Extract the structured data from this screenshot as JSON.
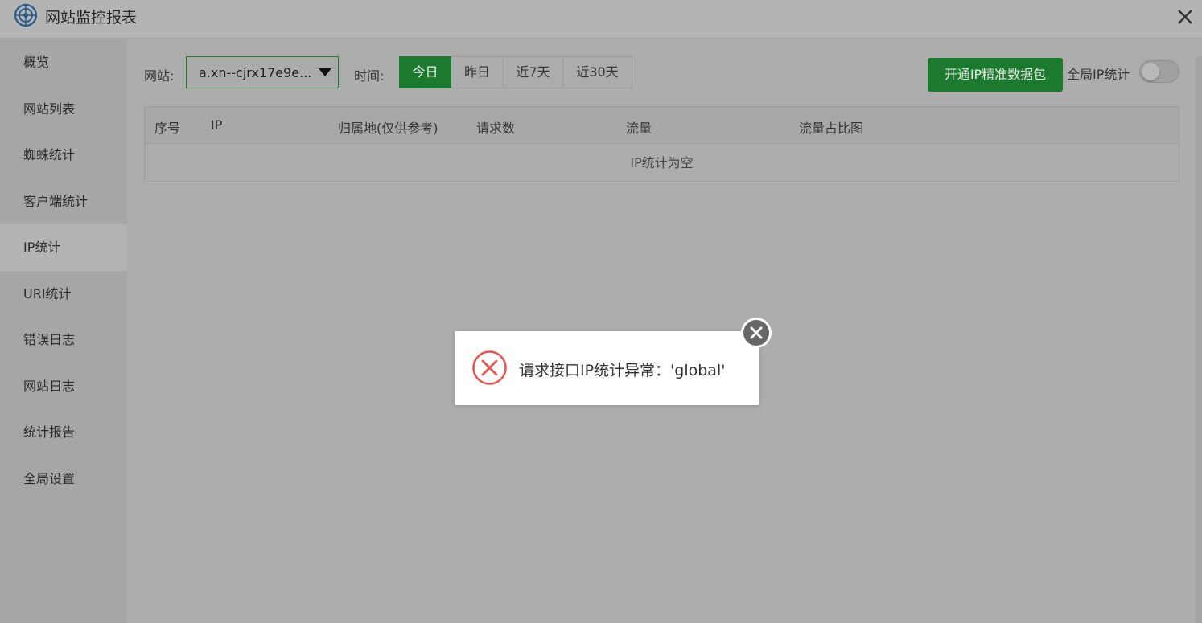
{
  "window": {
    "title": "网站监控报表",
    "logo_icon": "monitor-logo-icon",
    "close_icon": "close-icon"
  },
  "sidebar": {
    "items": [
      {
        "label": "概览",
        "active": false
      },
      {
        "label": "网站列表",
        "active": false
      },
      {
        "label": "蜘蛛统计",
        "active": false
      },
      {
        "label": "客户端统计",
        "active": false
      },
      {
        "label": "IP统计",
        "active": true
      },
      {
        "label": "URI统计",
        "active": false
      },
      {
        "label": "错误日志",
        "active": false
      },
      {
        "label": "网站日志",
        "active": false
      },
      {
        "label": "统计报告",
        "active": false
      },
      {
        "label": "全局设置",
        "active": false
      }
    ]
  },
  "toolbar": {
    "site_label": "网站:",
    "site_value": "a.xn--cjrx17e9e...",
    "time_label": "时间:",
    "tabs": [
      {
        "label": "今日",
        "active": true
      },
      {
        "label": "昨日",
        "active": false
      },
      {
        "label": "近7天",
        "active": false
      },
      {
        "label": "近30天",
        "active": false
      }
    ],
    "buy_button": "开通IP精准数据包",
    "global_ip_label": "全局IP统计",
    "global_ip_enabled": false
  },
  "table": {
    "headers": [
      "序号",
      "IP",
      "归属地(仅供参考)",
      "请求数",
      "流量",
      "流量占比图"
    ],
    "empty_text": "IP统计为空"
  },
  "dialog": {
    "message": "请求接口IP统计异常：'global'",
    "icon": "error-icon",
    "close_icon": "close-circle-icon"
  },
  "colors": {
    "accent_green": "#1b7a2d",
    "error_red": "#e8554e",
    "overlay_gray": "#adadad"
  }
}
